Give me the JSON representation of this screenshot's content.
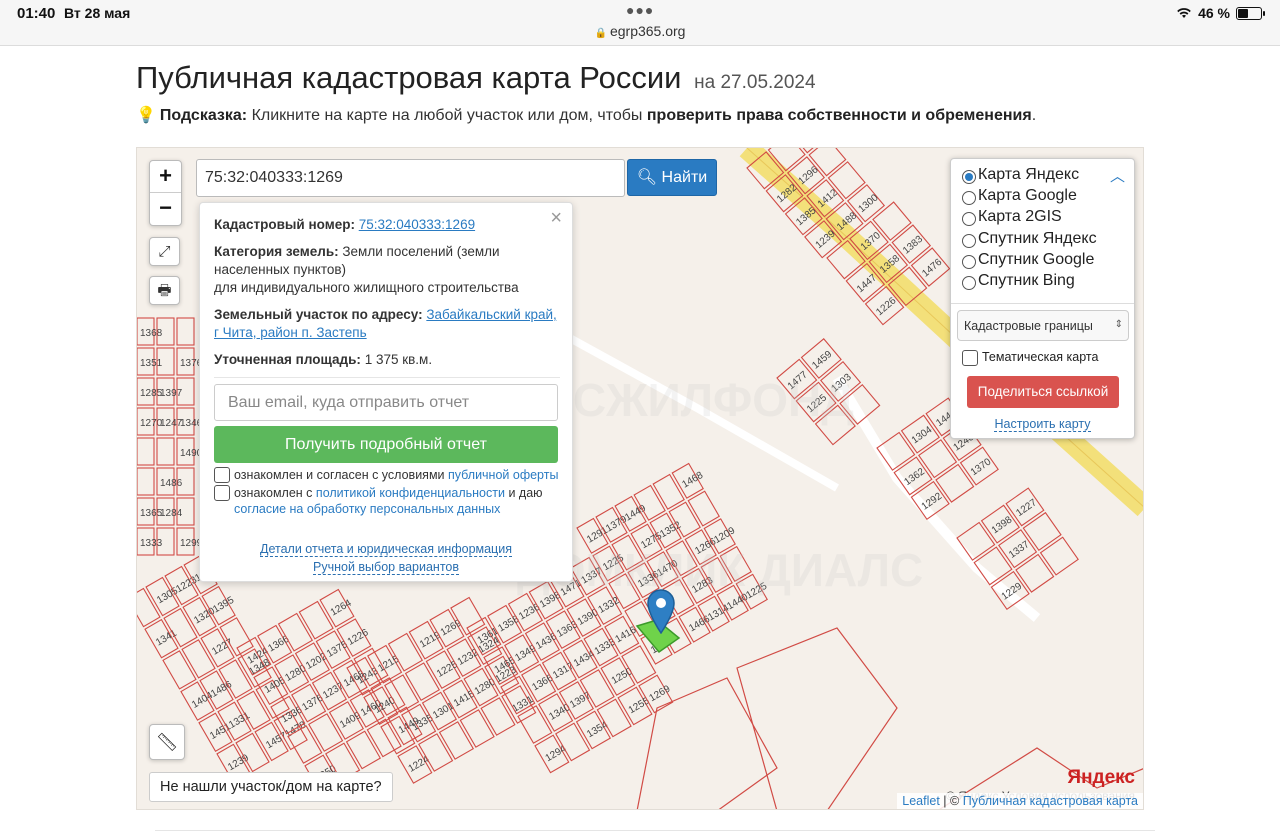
{
  "status": {
    "time": "01:40",
    "date": "Вт 28 мая",
    "url": "egrp365.org",
    "battery": "46 %",
    "battery_level": 0.46
  },
  "page": {
    "title": "Публичная кадастровая карта России",
    "title_date": "на 27.05.2024",
    "hint_label": "Подсказка:",
    "hint_text": "Кликните на карте на любой участок или дом, чтобы",
    "hint_bold": "проверить права собственности и обременения",
    "hint_end": "."
  },
  "map": {
    "zoom_in": "+",
    "zoom_out": "−",
    "search_value": "75:32:040333:1269",
    "search_button": "Найти",
    "not_found": "Не нашли участок/дом на карте?",
    "yandex_logo": "Яндекс",
    "yandex_terms": "© Яндекс  Условия использования",
    "attribution_leaflet": "Leaflet",
    "attribution_sep": "| ©",
    "attribution_source": "Публичная кадастровая карта",
    "watermark_1": "РОСЖИЛФОНД",
    "watermark_2": "ДОМКЛИК ДИАЛС"
  },
  "popup": {
    "close": "×",
    "cad_label": "Кадастровый номер:",
    "cad_value": "75:32:040333:1269",
    "cat_label": "Категория земель:",
    "cat_value": "Земли поселений (земли населенных пунктов)",
    "cat_value2": "для индивидуального жилищного строительства",
    "addr_label": "Земельный участок по адресу:",
    "addr_value": "Забайкальский край, г Чита, район п. Застепь",
    "area_label": "Уточненная площадь:",
    "area_value": "1 375 кв.м.",
    "email_placeholder": "Ваш email, куда отправить отчет",
    "report_button": "Получить подробный отчет",
    "agree1_text": "ознакомлен и согласен с условиями",
    "agree1_link": "публичной оферты",
    "agree2_text": "ознакомлен с",
    "agree2_link": "политикой конфиденциальности",
    "agree2_mid": "и даю",
    "agree2_link2": "согласие на обработку персональных данных",
    "details_link": "Детали отчета и юридическая информация",
    "manual_link": "Ручной выбор вариантов"
  },
  "layers": {
    "options": [
      "Карта Яндекс",
      "Карта Google",
      "Карта 2GIS",
      "Спутник Яндекс",
      "Спутник Google",
      "Спутник Bing"
    ],
    "selected": "Карта Яндекс",
    "select_value": "Кадастровые границы",
    "thematic": "Тематическая карта",
    "share_button": "Поделиться ссылкой",
    "setup_link": "Настроить карту"
  },
  "colors": {
    "accent": "#2a7bc2",
    "report_green": "#5cb85c",
    "share_red": "#d9534f",
    "parcel_line": "#d14b45",
    "selected_parcel": "#6fd34a"
  }
}
